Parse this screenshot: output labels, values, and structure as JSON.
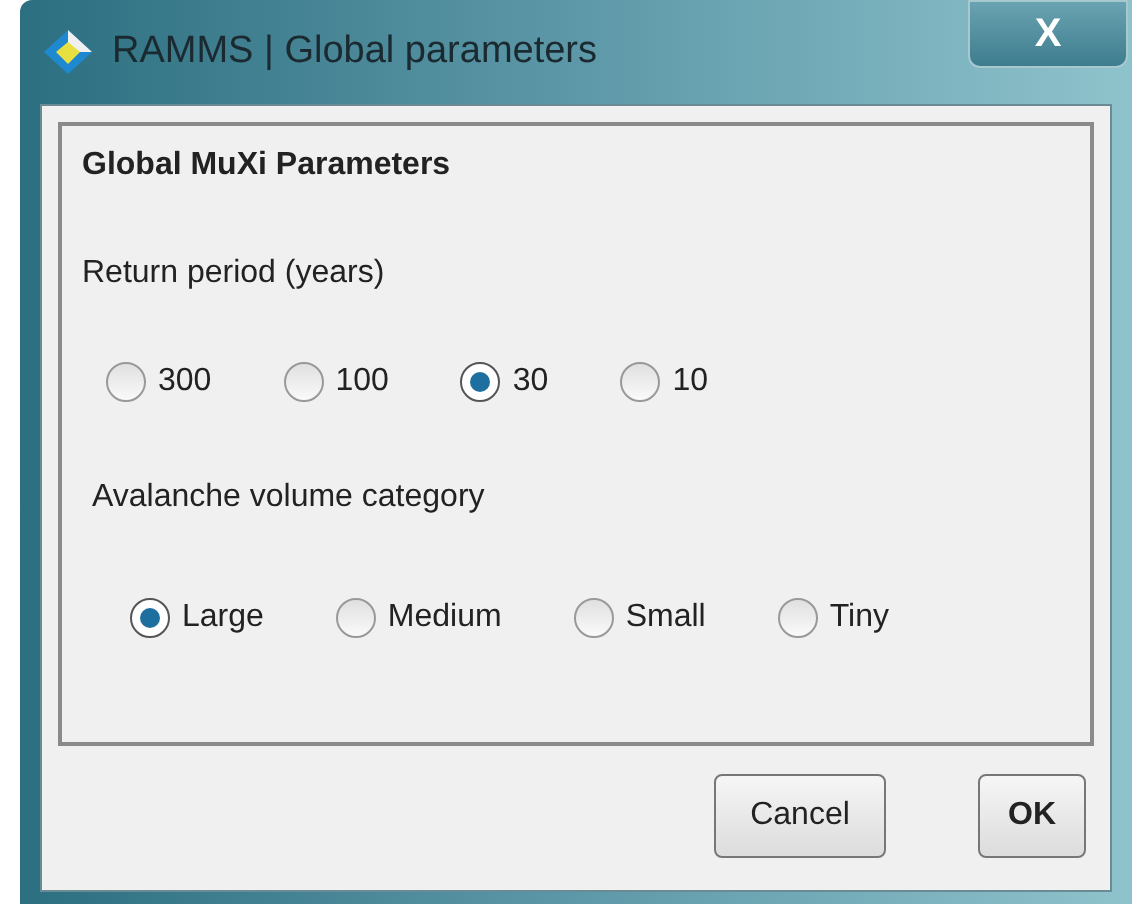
{
  "window": {
    "title": "RAMMS | Global parameters",
    "close": "X"
  },
  "panel": {
    "heading": "Global MuXi Parameters",
    "groups": [
      {
        "label": "Return period (years)",
        "options": [
          {
            "label": "300",
            "selected": false
          },
          {
            "label": "100",
            "selected": false
          },
          {
            "label": "30",
            "selected": true
          },
          {
            "label": "10",
            "selected": false
          }
        ]
      },
      {
        "label": "Avalanche volume category",
        "options": [
          {
            "label": "Large",
            "selected": true
          },
          {
            "label": "Medium",
            "selected": false
          },
          {
            "label": "Small",
            "selected": false
          },
          {
            "label": "Tiny",
            "selected": false
          }
        ]
      }
    ]
  },
  "buttons": [
    "Cancel",
    "OK"
  ]
}
